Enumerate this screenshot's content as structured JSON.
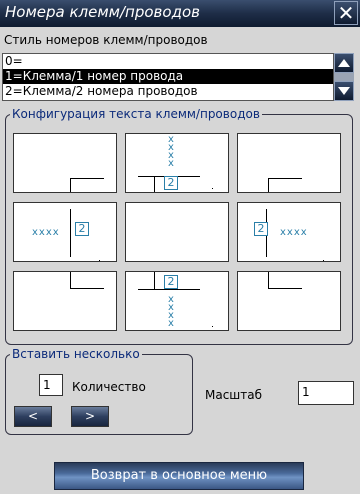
{
  "window": {
    "title": "Номера клемм/проводов",
    "close_glyph": "✕"
  },
  "style_label": "Стиль номеров клемм/проводов",
  "style_list": {
    "items": [
      "0=",
      "1=Клемма/1 номер провода",
      "2=Клемма/2 номера проводов"
    ],
    "selected_index": 1
  },
  "config_group": {
    "legend": "Конфигурация текста клемм/проводов",
    "text_placeholder": "xxxx",
    "wire_count": "2"
  },
  "insert_group": {
    "legend": "Вставить несколько",
    "quantity_value": "1",
    "quantity_label": "Количество",
    "prev_label": "<",
    "next_label": ">"
  },
  "scale": {
    "label": "Масштаб",
    "value": "1"
  },
  "main_menu_button": "Возврат в основное меню",
  "colors": {
    "title_bar": "#1e2d47",
    "accent_text": "#2a7fa8",
    "selection": "#000000"
  }
}
